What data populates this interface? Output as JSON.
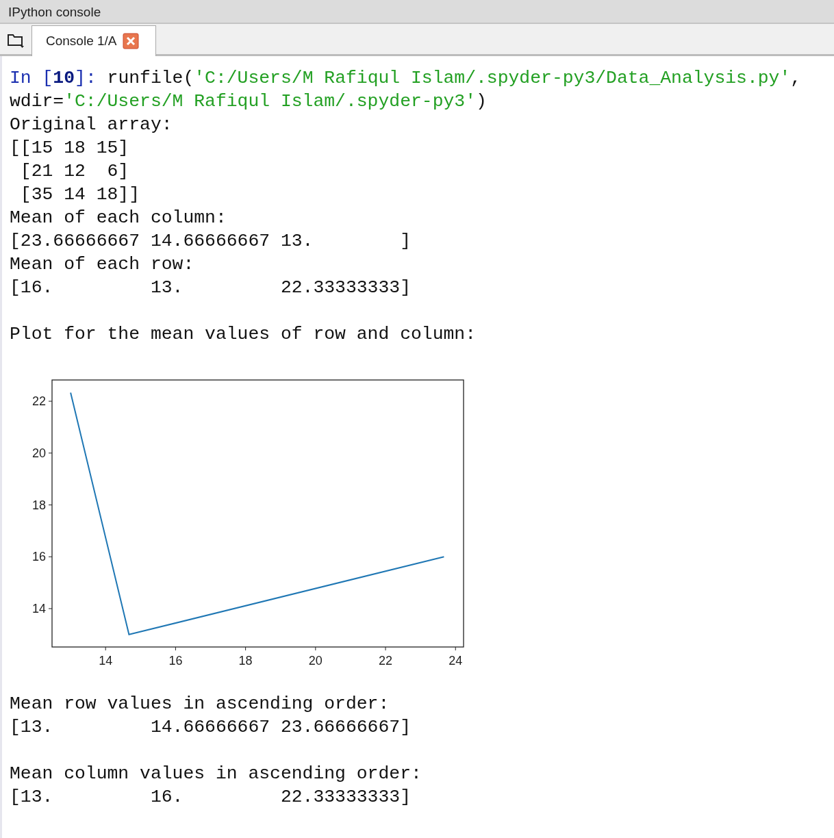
{
  "pane_title": "IPython console",
  "tabs": [
    {
      "label": "Console 1/A",
      "selected": true
    }
  ],
  "console": {
    "blocks": [
      {
        "lines": [
          [
            {
              "kind": "prompt",
              "text": "In ["
            },
            {
              "kind": "number",
              "text": "10"
            },
            {
              "kind": "prompt",
              "text": "]: "
            },
            {
              "kind": "code",
              "text": "runfile("
            },
            {
              "kind": "string",
              "text": "'C:/Users/M Rafiqul Islam/.spyder-py3/Data_Analysis.py'"
            },
            {
              "kind": "code",
              "text": ","
            }
          ],
          [
            {
              "kind": "code",
              "text": "wdir="
            },
            {
              "kind": "string",
              "text": "'C:/Users/M Rafiqul Islam/.spyder-py3'"
            },
            {
              "kind": "code",
              "text": ")"
            }
          ],
          [
            {
              "kind": "code",
              "text": "Original array:"
            }
          ],
          [
            {
              "kind": "code",
              "text": "[[15 18 15]"
            }
          ],
          [
            {
              "kind": "code",
              "text": " [21 12  6]"
            }
          ],
          [
            {
              "kind": "code",
              "text": " [35 14 18]]"
            }
          ],
          [
            {
              "kind": "code",
              "text": "Mean of each column:"
            }
          ],
          [
            {
              "kind": "code",
              "text": "[23.66666667 14.66666667 13.        ]"
            }
          ],
          [
            {
              "kind": "code",
              "text": "Mean of each row:"
            }
          ],
          [
            {
              "kind": "code",
              "text": "[16.         13.         22.33333333]"
            }
          ]
        ]
      },
      {
        "lines": [
          [
            {
              "kind": "code",
              "text": "Plot for the mean values of row and column:"
            }
          ]
        ]
      },
      {
        "chart_data": {
          "type": "line",
          "x": [
            23.67,
            14.67,
            13
          ],
          "series": [
            {
              "color": "#1f77b4",
              "values": [
                16,
                13,
                22.33
              ]
            }
          ],
          "xlim": [
            12.47,
            24.23
          ],
          "ylim": [
            12.52,
            22.82
          ],
          "xticks": [
            14,
            16,
            18,
            20,
            22,
            24
          ],
          "yticks": [
            14,
            16,
            18,
            20,
            22
          ]
        }
      },
      {
        "lines": [
          [
            {
              "kind": "code",
              "text": "Mean row values in ascending order:"
            }
          ],
          [
            {
              "kind": "code",
              "text": "[13.         14.66666667 23.66666667]"
            }
          ]
        ]
      },
      {
        "lines": [
          [
            {
              "kind": "code",
              "text": "Mean column values in ascending order:"
            }
          ],
          [
            {
              "kind": "code",
              "text": "[13.         16.         22.33333333]"
            }
          ]
        ]
      }
    ]
  }
}
